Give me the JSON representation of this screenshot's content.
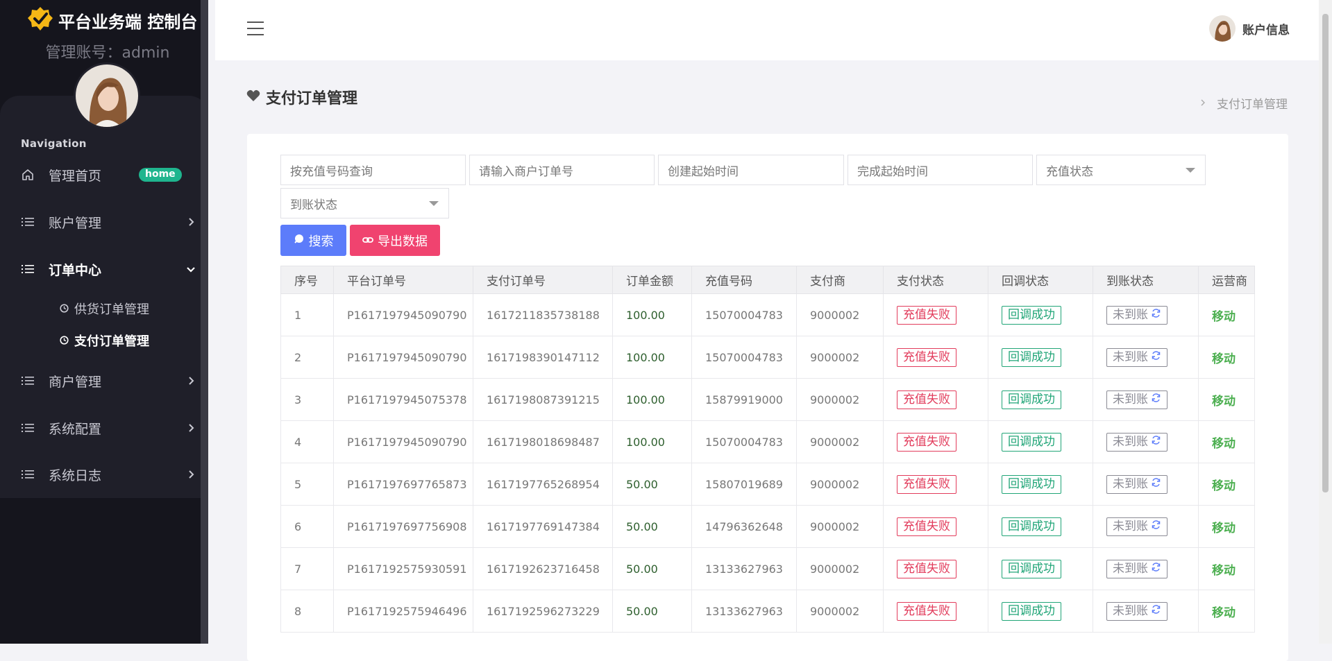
{
  "sidebar": {
    "brand": "平台业务端 控制台",
    "admin_label": "管理账号：admin",
    "nav_heading": "Navigation",
    "items": [
      {
        "label": "管理首页",
        "badge": "home"
      },
      {
        "label": "账户管理"
      },
      {
        "label": "订单中心"
      },
      {
        "label": "商户管理"
      },
      {
        "label": "系统配置"
      },
      {
        "label": "系统日志"
      }
    ],
    "sub_items": [
      {
        "label": "供货订单管理"
      },
      {
        "label": "支付订单管理"
      }
    ]
  },
  "topbar": {
    "account_label": "账户信息"
  },
  "page": {
    "title": "支付订单管理",
    "breadcrumb_current": "支付订单管理"
  },
  "filters": {
    "recharge_number": "按充值号码查询",
    "merchant_order": "请输入商户订单号",
    "create_start": "创建起始时间",
    "finish_start": "完成起始时间",
    "recharge_status": "充值状态",
    "arrival_status": "到账状态"
  },
  "buttons": {
    "search": "搜索",
    "export": "导出数据"
  },
  "table": {
    "headers": [
      "序号",
      "平台订单号",
      "支付订单号",
      "订单金额",
      "充值号码",
      "支付商",
      "支付状态",
      "回调状态",
      "到账状态",
      "运营商"
    ],
    "rows": [
      [
        "1",
        "P1617197945090790",
        "1617211835738188",
        "100.00",
        "15070004783",
        "9000002",
        "充值失败",
        "回调成功",
        "未到账",
        "移动"
      ],
      [
        "2",
        "P1617197945090790",
        "1617198390147112",
        "100.00",
        "15070004783",
        "9000002",
        "充值失败",
        "回调成功",
        "未到账",
        "移动"
      ],
      [
        "3",
        "P1617197945075378",
        "1617198087391215",
        "100.00",
        "15879919000",
        "9000002",
        "充值失败",
        "回调成功",
        "未到账",
        "移动"
      ],
      [
        "4",
        "P1617197945090790",
        "1617198018698487",
        "100.00",
        "15070004783",
        "9000002",
        "充值失败",
        "回调成功",
        "未到账",
        "移动"
      ],
      [
        "5",
        "P1617197697765873",
        "1617197765268954",
        "50.00",
        "15807019689",
        "9000002",
        "充值失败",
        "回调成功",
        "未到账",
        "移动"
      ],
      [
        "6",
        "P1617197697756908",
        "1617197769147384",
        "50.00",
        "14796362648",
        "9000002",
        "充值失败",
        "回调成功",
        "未到账",
        "移动"
      ],
      [
        "7",
        "P1617192575930591",
        "1617192623716458",
        "50.00",
        "13133627963",
        "9000002",
        "充值失败",
        "回调成功",
        "未到账",
        "移动"
      ],
      [
        "8",
        "P1617192575946496",
        "1617192596273229",
        "50.00",
        "13133627963",
        "9000002",
        "充值失败",
        "回调成功",
        "未到账",
        "移动"
      ]
    ]
  },
  "colors": {
    "accent_blue": "#5c7cfa",
    "accent_pink": "#f0436f",
    "success": "#20a577",
    "danger": "#e23b5b",
    "carrier": "#4caf50"
  },
  "icons": [
    "brand-check-icon",
    "home-icon",
    "list-icon",
    "chevron-right-icon",
    "chevron-down-icon",
    "clock-icon",
    "hamburger-icon",
    "heart-icon",
    "search-icon",
    "link-icon",
    "refresh-icon"
  ]
}
